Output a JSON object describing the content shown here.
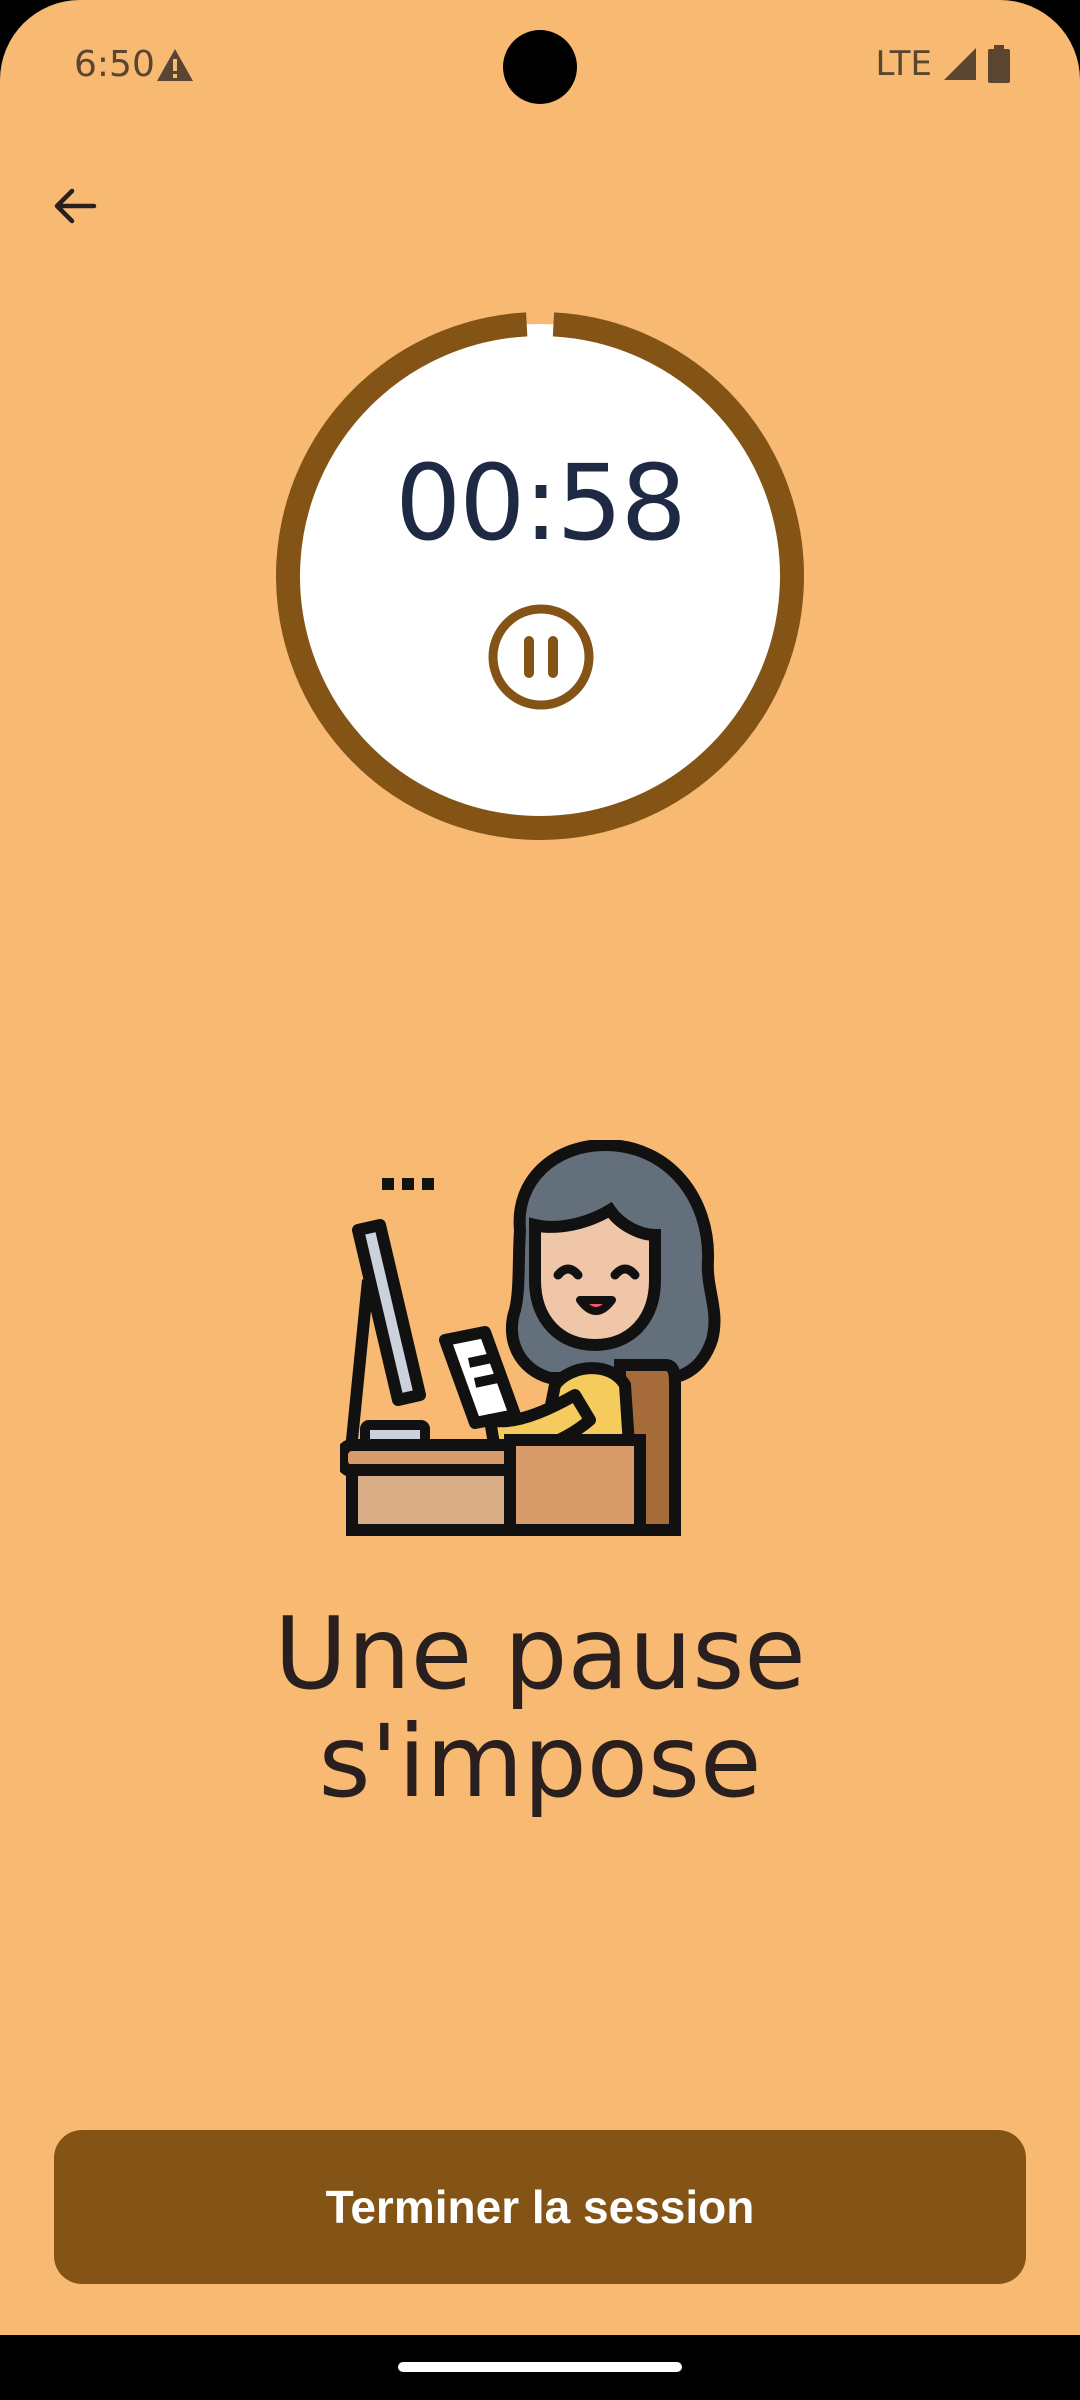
{
  "status_bar": {
    "time": "6:50",
    "network": "LTE",
    "icons": [
      "warning-icon",
      "signal-icon",
      "battery-icon"
    ]
  },
  "nav": {
    "back_icon": "arrow-left-icon"
  },
  "timer": {
    "time_display": "00:58",
    "progress": 0.983,
    "pause_icon": "pause-icon"
  },
  "illustration": {
    "icon": "person-at-computer-icon"
  },
  "message": {
    "line1": "Une pause",
    "line2": "s'impose"
  },
  "actions": {
    "end_session_label": "Terminer la session"
  },
  "colors": {
    "background": "#F8BA73",
    "accent": "#845416",
    "timer_text": "#1E2A44"
  }
}
